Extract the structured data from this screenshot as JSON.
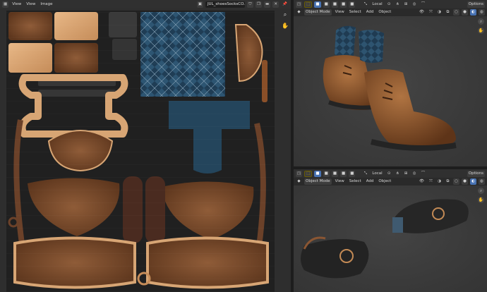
{
  "uv_editor": {
    "menu": [
      "View",
      "View",
      "Image"
    ],
    "image_name": "JUL_shoesSocksCO...",
    "nav_icons": [
      "zoom-icon",
      "hand-icon"
    ]
  },
  "viewport_top": {
    "orientation": "Local",
    "mode": "Object Mode",
    "menu": [
      "View",
      "Select",
      "Add",
      "Object"
    ],
    "options": "Options"
  },
  "viewport_bottom": {
    "orientation": "Local",
    "mode": "Object Mode",
    "menu": [
      "View",
      "Select",
      "Add",
      "Object"
    ],
    "options": "Options"
  },
  "colors": {
    "accent": "#4772b3",
    "sock_blue": "#2f4e68",
    "leather": "#8a5633",
    "leather_light": "#d7a574",
    "sole": "#232323"
  }
}
